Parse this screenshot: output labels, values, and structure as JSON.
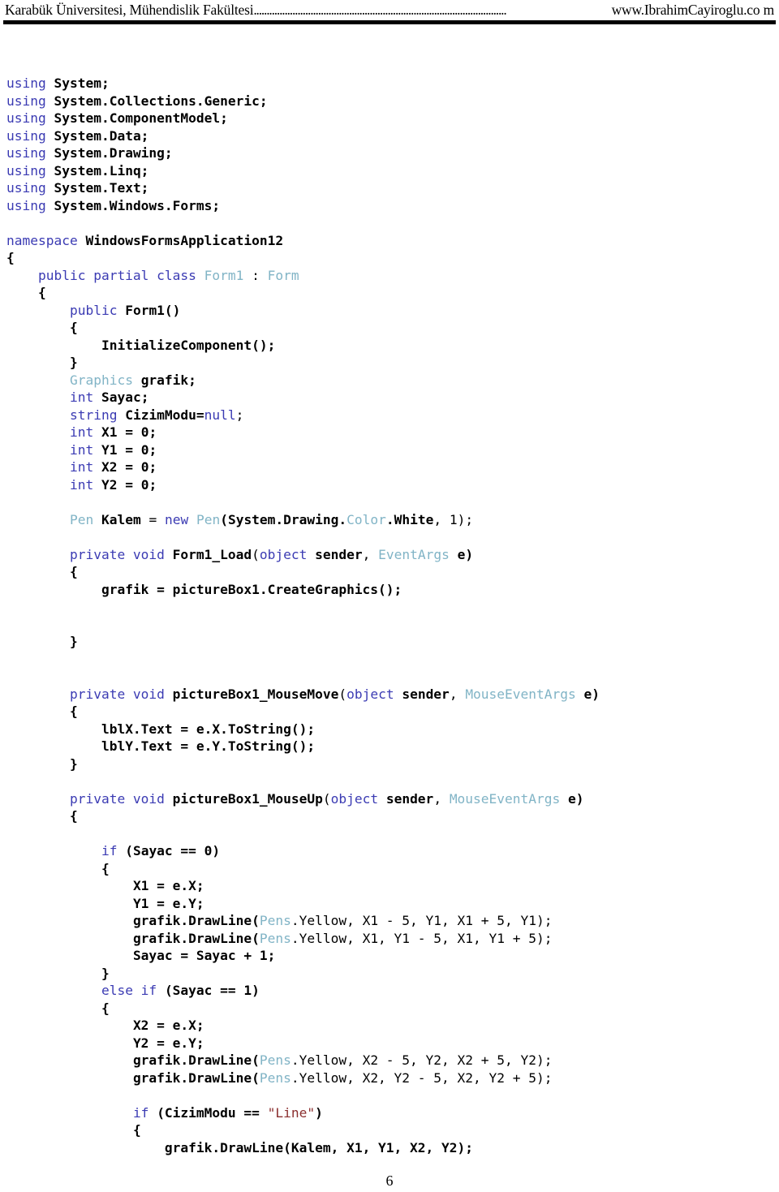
{
  "document": {
    "page_number": "6"
  },
  "header": {
    "left_text": "Karabük Üniversitesi, Mühendislik Fakültesi",
    "dots": "..................................................................................................",
    "right_text": "www.IbrahimCayiroglu.co m"
  },
  "code": {
    "language": "csharp",
    "colors": {
      "keyword": "#3b3bb3",
      "type": "#81b4c6",
      "identifier": "#000000",
      "string": "#8b2f2f",
      "plain": "#000000"
    },
    "lines": [
      {
        "indent": "",
        "tokens": [
          {
            "t": "using",
            "c": "kw"
          },
          {
            "t": " ",
            "c": "pl"
          },
          {
            "t": "System;",
            "c": "id"
          }
        ]
      },
      {
        "indent": "",
        "tokens": [
          {
            "t": "using",
            "c": "kw"
          },
          {
            "t": " ",
            "c": "pl"
          },
          {
            "t": "System.Collections.Generic;",
            "c": "id"
          }
        ]
      },
      {
        "indent": "",
        "tokens": [
          {
            "t": "using",
            "c": "kw"
          },
          {
            "t": " ",
            "c": "pl"
          },
          {
            "t": "System.ComponentModel;",
            "c": "id"
          }
        ]
      },
      {
        "indent": "",
        "tokens": [
          {
            "t": "using",
            "c": "kw"
          },
          {
            "t": " ",
            "c": "pl"
          },
          {
            "t": "System.Data;",
            "c": "id"
          }
        ]
      },
      {
        "indent": "",
        "tokens": [
          {
            "t": "using",
            "c": "kw"
          },
          {
            "t": " ",
            "c": "pl"
          },
          {
            "t": "System.Drawing;",
            "c": "id"
          }
        ]
      },
      {
        "indent": "",
        "tokens": [
          {
            "t": "using",
            "c": "kw"
          },
          {
            "t": " ",
            "c": "pl"
          },
          {
            "t": "System.Linq;",
            "c": "id"
          }
        ]
      },
      {
        "indent": "",
        "tokens": [
          {
            "t": "using",
            "c": "kw"
          },
          {
            "t": " ",
            "c": "pl"
          },
          {
            "t": "System.Text;",
            "c": "id"
          }
        ]
      },
      {
        "indent": "",
        "tokens": [
          {
            "t": "using",
            "c": "kw"
          },
          {
            "t": " ",
            "c": "pl"
          },
          {
            "t": "System.Windows.Forms;",
            "c": "id"
          }
        ]
      },
      {
        "indent": "",
        "tokens": []
      },
      {
        "indent": "",
        "tokens": [
          {
            "t": "namespace",
            "c": "kw"
          },
          {
            "t": " ",
            "c": "pl"
          },
          {
            "t": "WindowsFormsApplication12",
            "c": "id"
          }
        ]
      },
      {
        "indent": "",
        "tokens": [
          {
            "t": "{",
            "c": "id"
          }
        ]
      },
      {
        "indent": "    ",
        "tokens": [
          {
            "t": "public partial class",
            "c": "kw"
          },
          {
            "t": " ",
            "c": "pl"
          },
          {
            "t": "Form1",
            "c": "ty"
          },
          {
            "t": " : ",
            "c": "pl"
          },
          {
            "t": "Form",
            "c": "ty"
          }
        ]
      },
      {
        "indent": "    ",
        "tokens": [
          {
            "t": "{",
            "c": "id"
          }
        ]
      },
      {
        "indent": "        ",
        "tokens": [
          {
            "t": "public",
            "c": "kw"
          },
          {
            "t": " ",
            "c": "pl"
          },
          {
            "t": "Form1()",
            "c": "id"
          }
        ]
      },
      {
        "indent": "        ",
        "tokens": [
          {
            "t": "{",
            "c": "id"
          }
        ]
      },
      {
        "indent": "            ",
        "tokens": [
          {
            "t": "InitializeComponent();",
            "c": "id"
          }
        ]
      },
      {
        "indent": "        ",
        "tokens": [
          {
            "t": "}",
            "c": "id"
          }
        ]
      },
      {
        "indent": "        ",
        "tokens": [
          {
            "t": "Graphics",
            "c": "ty"
          },
          {
            "t": " ",
            "c": "pl"
          },
          {
            "t": "grafik;",
            "c": "id"
          }
        ]
      },
      {
        "indent": "        ",
        "tokens": [
          {
            "t": "int",
            "c": "kw"
          },
          {
            "t": " ",
            "c": "pl"
          },
          {
            "t": "Sayac;",
            "c": "id"
          }
        ]
      },
      {
        "indent": "        ",
        "tokens": [
          {
            "t": "string",
            "c": "kw"
          },
          {
            "t": " ",
            "c": "pl"
          },
          {
            "t": "CizimModu=",
            "c": "id"
          },
          {
            "t": "null",
            "c": "kw"
          },
          {
            "t": ";",
            "c": "pl"
          }
        ]
      },
      {
        "indent": "        ",
        "tokens": [
          {
            "t": "int",
            "c": "kw"
          },
          {
            "t": " ",
            "c": "pl"
          },
          {
            "t": "X1 = 0;",
            "c": "id"
          }
        ]
      },
      {
        "indent": "        ",
        "tokens": [
          {
            "t": "int",
            "c": "kw"
          },
          {
            "t": " ",
            "c": "pl"
          },
          {
            "t": "Y1 = 0;",
            "c": "id"
          }
        ]
      },
      {
        "indent": "        ",
        "tokens": [
          {
            "t": "int",
            "c": "kw"
          },
          {
            "t": " ",
            "c": "pl"
          },
          {
            "t": "X2 = 0;",
            "c": "id"
          }
        ]
      },
      {
        "indent": "        ",
        "tokens": [
          {
            "t": "int",
            "c": "kw"
          },
          {
            "t": " ",
            "c": "pl"
          },
          {
            "t": "Y2 = 0;",
            "c": "id"
          }
        ]
      },
      {
        "indent": "",
        "tokens": []
      },
      {
        "indent": "        ",
        "tokens": [
          {
            "t": "Pen",
            "c": "ty"
          },
          {
            "t": " ",
            "c": "pl"
          },
          {
            "t": "Kalem",
            "c": "id"
          },
          {
            "t": " = ",
            "c": "pl"
          },
          {
            "t": "new",
            "c": "kw"
          },
          {
            "t": " ",
            "c": "pl"
          },
          {
            "t": "Pen",
            "c": "ty"
          },
          {
            "t": "(System.Drawing.",
            "c": "id"
          },
          {
            "t": "Color",
            "c": "ty"
          },
          {
            "t": ".White",
            "c": "id"
          },
          {
            "t": ", 1);",
            "c": "pl"
          }
        ]
      },
      {
        "indent": "",
        "tokens": []
      },
      {
        "indent": "        ",
        "tokens": [
          {
            "t": "private void",
            "c": "kw"
          },
          {
            "t": " ",
            "c": "pl"
          },
          {
            "t": "Form1_Load",
            "c": "id"
          },
          {
            "t": "(",
            "c": "pl"
          },
          {
            "t": "object",
            "c": "kw"
          },
          {
            "t": " ",
            "c": "pl"
          },
          {
            "t": "sender",
            "c": "id"
          },
          {
            "t": ", ",
            "c": "pl"
          },
          {
            "t": "EventArgs",
            "c": "ty"
          },
          {
            "t": " ",
            "c": "pl"
          },
          {
            "t": "e)",
            "c": "id"
          }
        ]
      },
      {
        "indent": "        ",
        "tokens": [
          {
            "t": "{",
            "c": "id"
          }
        ]
      },
      {
        "indent": "            ",
        "tokens": [
          {
            "t": "grafik = pictureBox1.CreateGraphics();",
            "c": "id"
          }
        ]
      },
      {
        "indent": "",
        "tokens": []
      },
      {
        "indent": "",
        "tokens": []
      },
      {
        "indent": "        ",
        "tokens": [
          {
            "t": "}",
            "c": "id"
          }
        ]
      },
      {
        "indent": "",
        "tokens": []
      },
      {
        "indent": "",
        "tokens": []
      },
      {
        "indent": "        ",
        "tokens": [
          {
            "t": "private void",
            "c": "kw"
          },
          {
            "t": " ",
            "c": "pl"
          },
          {
            "t": "pictureBox1_MouseMove",
            "c": "id"
          },
          {
            "t": "(",
            "c": "pl"
          },
          {
            "t": "object",
            "c": "kw"
          },
          {
            "t": " ",
            "c": "pl"
          },
          {
            "t": "sender",
            "c": "id"
          },
          {
            "t": ", ",
            "c": "pl"
          },
          {
            "t": "MouseEventArgs",
            "c": "ty"
          },
          {
            "t": " ",
            "c": "pl"
          },
          {
            "t": "e)",
            "c": "id"
          }
        ]
      },
      {
        "indent": "        ",
        "tokens": [
          {
            "t": "{",
            "c": "id"
          }
        ]
      },
      {
        "indent": "            ",
        "tokens": [
          {
            "t": "lblX.Text = e.X.ToString();",
            "c": "id"
          }
        ]
      },
      {
        "indent": "            ",
        "tokens": [
          {
            "t": "lblY.Text = e.Y.ToString();",
            "c": "id"
          }
        ]
      },
      {
        "indent": "        ",
        "tokens": [
          {
            "t": "}",
            "c": "id"
          }
        ]
      },
      {
        "indent": "",
        "tokens": []
      },
      {
        "indent": "        ",
        "tokens": [
          {
            "t": "private void",
            "c": "kw"
          },
          {
            "t": " ",
            "c": "pl"
          },
          {
            "t": "pictureBox1_MouseUp",
            "c": "id"
          },
          {
            "t": "(",
            "c": "pl"
          },
          {
            "t": "object",
            "c": "kw"
          },
          {
            "t": " ",
            "c": "pl"
          },
          {
            "t": "sender",
            "c": "id"
          },
          {
            "t": ", ",
            "c": "pl"
          },
          {
            "t": "MouseEventArgs",
            "c": "ty"
          },
          {
            "t": " ",
            "c": "pl"
          },
          {
            "t": "e)",
            "c": "id"
          }
        ]
      },
      {
        "indent": "        ",
        "tokens": [
          {
            "t": "{",
            "c": "id"
          }
        ]
      },
      {
        "indent": "",
        "tokens": []
      },
      {
        "indent": "            ",
        "tokens": [
          {
            "t": "if",
            "c": "kw"
          },
          {
            "t": " ",
            "c": "pl"
          },
          {
            "t": "(Sayac == 0)",
            "c": "id"
          }
        ]
      },
      {
        "indent": "            ",
        "tokens": [
          {
            "t": "{",
            "c": "id"
          }
        ]
      },
      {
        "indent": "                ",
        "tokens": [
          {
            "t": "X1 = e.X;",
            "c": "id"
          }
        ]
      },
      {
        "indent": "                ",
        "tokens": [
          {
            "t": "Y1 = e.Y;",
            "c": "id"
          }
        ]
      },
      {
        "indent": "                ",
        "tokens": [
          {
            "t": "grafik.DrawLine(",
            "c": "id"
          },
          {
            "t": "Pens",
            "c": "ty"
          },
          {
            "t": ".Yellow, X1 - 5, Y1, X1 + 5, Y1);",
            "c": "pl"
          }
        ]
      },
      {
        "indent": "                ",
        "tokens": [
          {
            "t": "grafik.DrawLine(",
            "c": "id"
          },
          {
            "t": "Pens",
            "c": "ty"
          },
          {
            "t": ".Yellow, X1, Y1 - 5, X1, Y1 + 5);",
            "c": "pl"
          }
        ]
      },
      {
        "indent": "                ",
        "tokens": [
          {
            "t": "Sayac = Sayac + 1;",
            "c": "id"
          }
        ]
      },
      {
        "indent": "            ",
        "tokens": [
          {
            "t": "}",
            "c": "id"
          }
        ]
      },
      {
        "indent": "            ",
        "tokens": [
          {
            "t": "else if",
            "c": "kw"
          },
          {
            "t": " ",
            "c": "pl"
          },
          {
            "t": "(Sayac == 1)",
            "c": "id"
          }
        ]
      },
      {
        "indent": "            ",
        "tokens": [
          {
            "t": "{",
            "c": "id"
          }
        ]
      },
      {
        "indent": "                ",
        "tokens": [
          {
            "t": "X2 = e.X;",
            "c": "id"
          }
        ]
      },
      {
        "indent": "                ",
        "tokens": [
          {
            "t": "Y2 = e.Y;",
            "c": "id"
          }
        ]
      },
      {
        "indent": "                ",
        "tokens": [
          {
            "t": "grafik.DrawLine(",
            "c": "id"
          },
          {
            "t": "Pens",
            "c": "ty"
          },
          {
            "t": ".Yellow, X2 - 5, Y2, X2 + 5, Y2);",
            "c": "pl"
          }
        ]
      },
      {
        "indent": "                ",
        "tokens": [
          {
            "t": "grafik.DrawLine(",
            "c": "id"
          },
          {
            "t": "Pens",
            "c": "ty"
          },
          {
            "t": ".Yellow, X2, Y2 - 5, X2, Y2 + 5);",
            "c": "pl"
          }
        ]
      },
      {
        "indent": "",
        "tokens": []
      },
      {
        "indent": "                ",
        "tokens": [
          {
            "t": "if",
            "c": "kw"
          },
          {
            "t": " ",
            "c": "pl"
          },
          {
            "t": "(CizimModu == ",
            "c": "id"
          },
          {
            "t": "\"Line\"",
            "c": "str"
          },
          {
            "t": ")",
            "c": "id"
          }
        ]
      },
      {
        "indent": "                ",
        "tokens": [
          {
            "t": "{",
            "c": "id"
          }
        ]
      },
      {
        "indent": "                    ",
        "tokens": [
          {
            "t": "grafik.DrawLine(Kalem, X1, Y1, X2, Y2);",
            "c": "id"
          }
        ]
      }
    ]
  }
}
